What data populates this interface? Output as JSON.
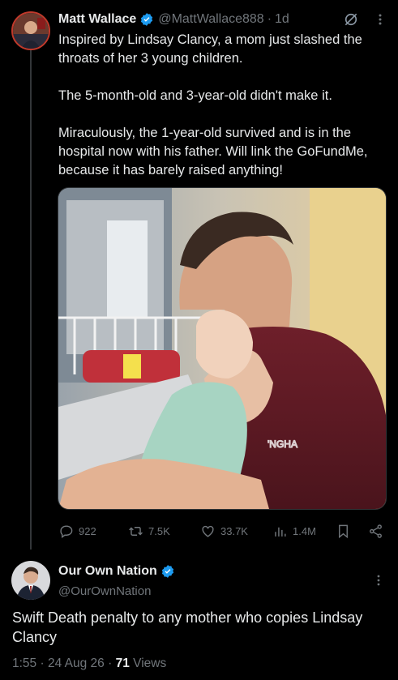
{
  "tweet": {
    "author_name": "Matt Wallace",
    "handle": "@MattWallace888",
    "separator": "·",
    "time": "1d",
    "paragraphs": [
      "Inspired by Lindsay Clancy, a mom just slashed the throats of her 3 young children.",
      "The 5-month-old and 3-year-old didn't make it.",
      "Miraculously, the 1-year-old survived and is in the hospital now with his father. Will link the GoFundMe, because it has barely raised anything!"
    ],
    "replies": "922",
    "reposts": "7.5K",
    "likes": "33.7K",
    "views": "1.4M"
  },
  "reply": {
    "author_name": "Our Own Nation",
    "handle": "@OurOwnNation",
    "text": "Swift Death penalty to any mother who copies Lindsay Clancy",
    "time": "1:55",
    "dot": "·",
    "date": "24 Aug 26",
    "views_count": "71",
    "views_label": "Views"
  },
  "colors": {
    "background": "#000000",
    "text": "#e7e9ea",
    "muted": "#71767b",
    "verified": "#1d9bf0"
  },
  "icons": [
    "verified-badge-icon",
    "grok-icon",
    "more-icon",
    "reply-icon",
    "repost-icon",
    "like-icon",
    "views-icon",
    "bookmark-icon",
    "share-icon"
  ]
}
